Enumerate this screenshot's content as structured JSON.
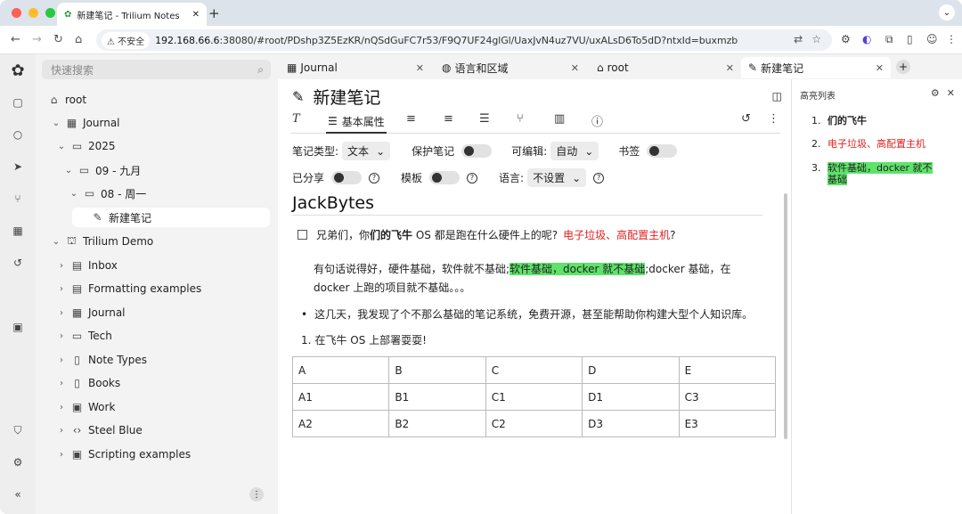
{
  "browser": {
    "tab_title": "新建笔记 - Trilium Notes",
    "security_label": "不安全",
    "url_host": "192.168.66.6",
    "url_rest": ":38080/#root/PDshp3Z5EzKR/nQSdGuFC7r53/F9Q7UF24glGl/UaxJvN4uz7VU/uxALsD6To5dD?ntxId=buxmzb"
  },
  "tree": {
    "search_placeholder": "快速搜索",
    "nodes": [
      "root",
      "Journal",
      "2025",
      "09 - 九月",
      "08 - 周一",
      "新建笔记",
      "Trilium Demo",
      "Inbox",
      "Formatting examples",
      "Journal",
      "Tech",
      "Note Types",
      "Books",
      "Work",
      "Steel Blue",
      "Scripting examples"
    ]
  },
  "note_tabs": [
    "Journal",
    "语言和区域",
    "root",
    "新建笔记"
  ],
  "note": {
    "title": "新建笔记",
    "ribbon_active": "基本属性",
    "props": {
      "type_label": "笔记类型:",
      "type_value": "文本",
      "protect_label": "保护笔记",
      "editable_label": "可编辑:",
      "editable_value": "自动",
      "bookmark_label": "书签",
      "shared_label": "已分享",
      "template_label": "模板",
      "language_label": "语言:",
      "language_value": "不设置"
    },
    "content": {
      "heading": "JackBytes",
      "l1a": "兄弟们，你",
      "l1b": "们的飞牛",
      "l1c": " OS 都是跑在什么硬件上的呢?",
      "l1d": "电子垃圾、高配置主机",
      "l1e": "?",
      "l2a": "有句话说得好，硬件基础，软件就不基础;",
      "l2b": "软件基础，docker 就不基础",
      "l2c": ";docker 基础，在",
      "l3": "docker 上跑的项目就不基础。。。",
      "bullet": "这几天，我发现了个不那么基础的笔记系统，免费开源，甚至能帮助你构建大型个人知识库。",
      "numbered": "在飞牛 OS 上部署耍耍!",
      "table": [
        [
          "A",
          "B",
          "C",
          "D",
          "E"
        ],
        [
          "A1",
          "B1",
          "C1",
          "D1",
          "C3"
        ],
        [
          "A2",
          "B2",
          "C2",
          "D3",
          "E3"
        ]
      ]
    }
  },
  "right_panel": {
    "title": "高亮列表",
    "items": [
      {
        "n": "1.",
        "text": "们的飞牛"
      },
      {
        "n": "2.",
        "text": "电子垃圾、高配置主机"
      },
      {
        "n": "3.",
        "text": "软件基础，docker 就不基础"
      }
    ]
  },
  "colors": {
    "highlight": "#5ee36a",
    "red": "#e02020"
  }
}
